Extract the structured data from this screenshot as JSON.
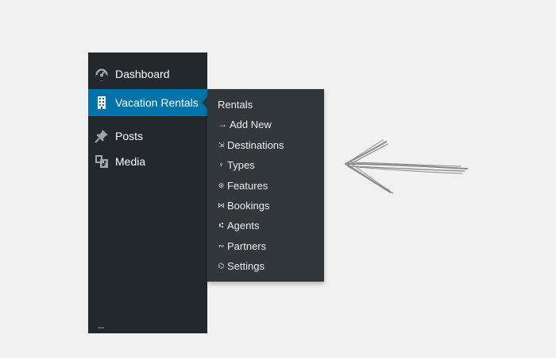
{
  "sidebar": {
    "items": [
      {
        "label": "Dashboard",
        "icon": "dashboard-icon"
      },
      {
        "label": "Vacation Rentals",
        "icon": "building-icon",
        "active": true
      },
      {
        "label": "Posts",
        "icon": "pin-icon"
      },
      {
        "label": "Media",
        "icon": "media-icon"
      }
    ]
  },
  "submenu": {
    "title": "Rentals",
    "items": [
      {
        "glyph": "→",
        "label": "Add New"
      },
      {
        "glyph": "⇲",
        "label": "Destinations"
      },
      {
        "glyph": "♆",
        "label": "Types"
      },
      {
        "glyph": "⊛",
        "label": "Features"
      },
      {
        "glyph": "⋈",
        "label": "Bookings"
      },
      {
        "glyph": "⑆",
        "label": "Agents"
      },
      {
        "glyph": "∾",
        "label": "Partners"
      },
      {
        "glyph": "⌬",
        "label": "Settings"
      }
    ]
  },
  "colors": {
    "sidebar_bg": "#23282d",
    "submenu_bg": "#32373c",
    "active_bg": "#0073aa",
    "page_bg": "#f1f1f1",
    "arrow": "#8a8a8a"
  }
}
